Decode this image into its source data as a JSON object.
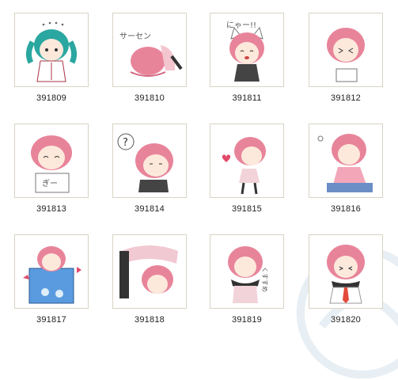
{
  "gallery": {
    "items": [
      {
        "id": "391809",
        "icon": "teal-hair-girl-sticker"
      },
      {
        "id": "391810",
        "icon": "bowing-pink-hair-sticker"
      },
      {
        "id": "391811",
        "icon": "cat-ears-pink-hair-sticker"
      },
      {
        "id": "391812",
        "icon": "pink-hair-sign-sticker"
      },
      {
        "id": "391813",
        "icon": "pink-hair-board-sticker"
      },
      {
        "id": "391814",
        "icon": "question-pink-hair-sticker"
      },
      {
        "id": "391815",
        "icon": "heart-pink-hair-sticker"
      },
      {
        "id": "391816",
        "icon": "sitting-pink-hair-sticker"
      },
      {
        "id": "391817",
        "icon": "bath-pink-hair-sticker"
      },
      {
        "id": "391818",
        "icon": "bending-pink-hair-sticker"
      },
      {
        "id": "391819",
        "icon": "scarf-pink-hair-sticker"
      },
      {
        "id": "391820",
        "icon": "tie-pink-hair-sticker"
      }
    ],
    "sticker_text": {
      "t810": "サーセン",
      "t811": "にゃー!!",
      "t813": "ぎー",
      "t814": "?",
      "t819": "くすすめ"
    },
    "colors": {
      "pink_hair": "#e8849a",
      "teal_hair": "#2aa7a0",
      "border": "#d9d3c3"
    }
  }
}
